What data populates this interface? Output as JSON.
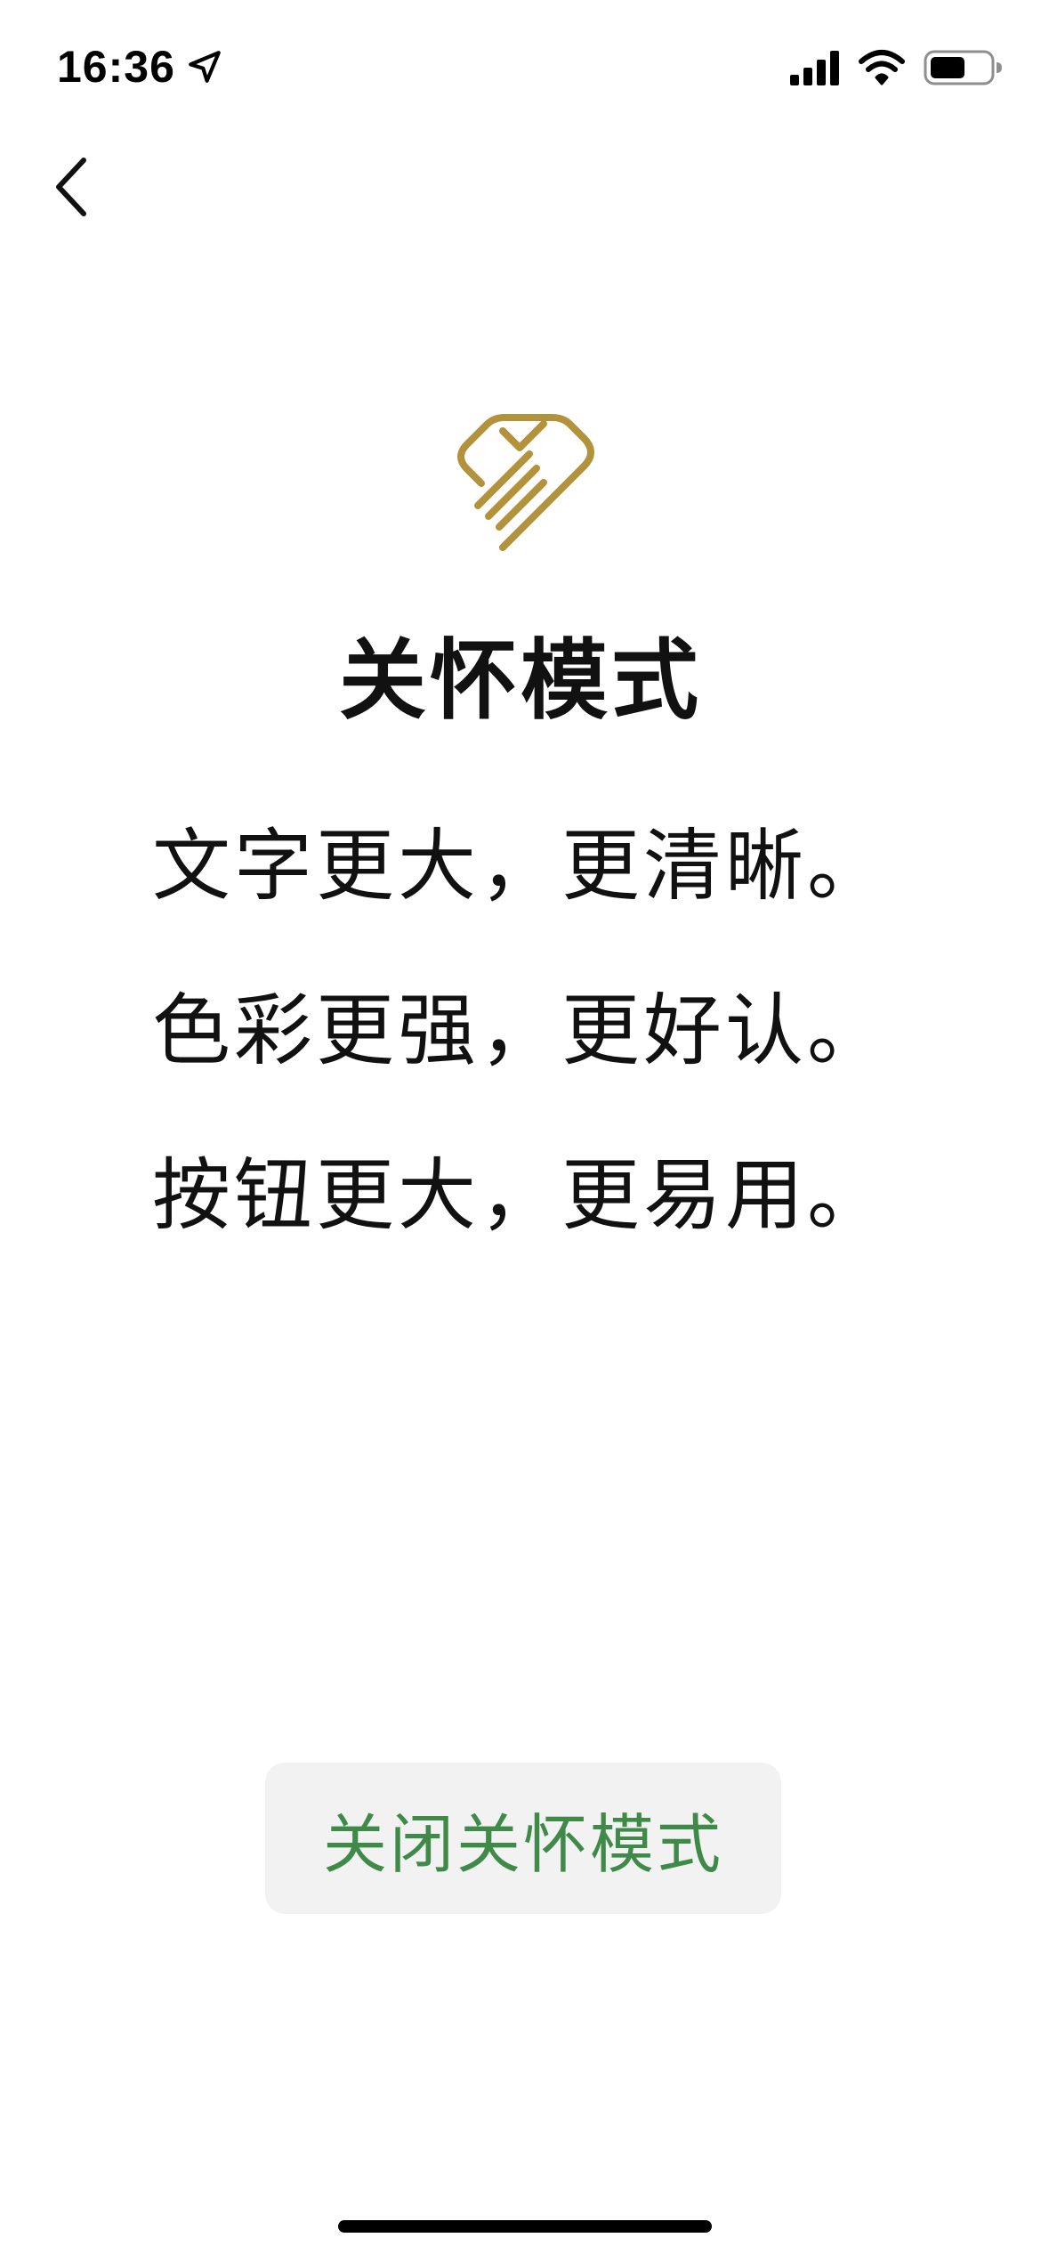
{
  "status_bar": {
    "time": "16:36",
    "location_icon": "location-arrow-icon",
    "signal_icon": "cellular-signal-icon",
    "wifi_icon": "wifi-icon",
    "battery_icon": "battery-icon",
    "battery_level": 0.6
  },
  "nav": {
    "back_icon": "chevron-left-icon"
  },
  "hero": {
    "logo_icon": "care-heart-hand-icon",
    "logo_color": "#b2933c",
    "title": "关怀模式",
    "features": [
      "文字更大，更清晰。",
      "色彩更强，更好认。",
      "按钮更大，更易用。"
    ]
  },
  "actions": {
    "close_label": "关闭关怀模式",
    "close_color": "#3f8a48",
    "close_background": "#f2f2f2"
  }
}
